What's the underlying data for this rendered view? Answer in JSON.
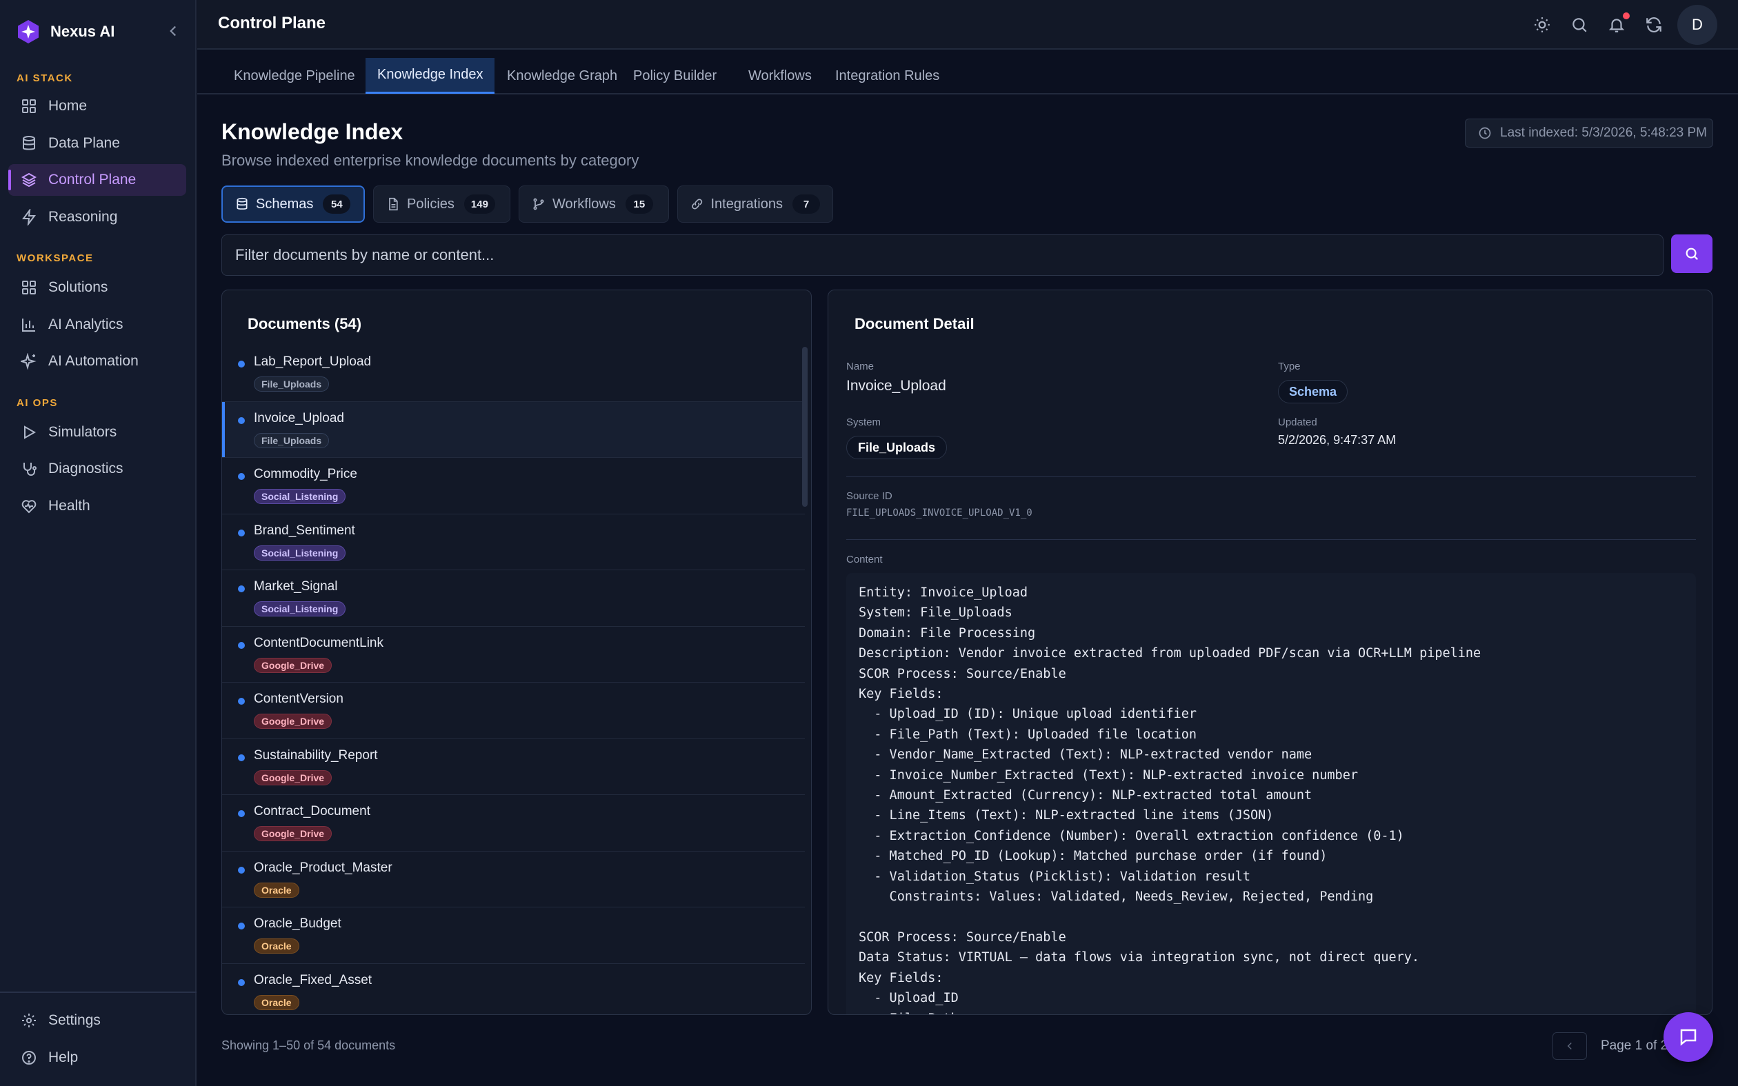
{
  "app": {
    "name": "Nexus AI",
    "brand_color": "#7c3aed",
    "accent_color": "#3b82f6"
  },
  "sidebar": {
    "sections": [
      {
        "label": "AI STACK",
        "items": [
          {
            "label": "Home",
            "icon": "grid-icon"
          },
          {
            "label": "Data Plane",
            "icon": "database-icon"
          },
          {
            "label": "Control Plane",
            "icon": "layers-icon",
            "active": true
          },
          {
            "label": "Reasoning",
            "icon": "bolt-icon"
          }
        ]
      },
      {
        "label": "WORKSPACE",
        "items": [
          {
            "label": "Solutions",
            "icon": "grid-icon"
          },
          {
            "label": "AI Analytics",
            "icon": "bar-chart-icon"
          },
          {
            "label": "AI Automation",
            "icon": "sparkle-icon"
          }
        ]
      },
      {
        "label": "AI OPS",
        "items": [
          {
            "label": "Simulators",
            "icon": "play-icon"
          },
          {
            "label": "Diagnostics",
            "icon": "stethoscope-icon"
          },
          {
            "label": "Health",
            "icon": "heart-pulse-icon"
          }
        ]
      }
    ],
    "bottom": [
      {
        "label": "Settings",
        "icon": "gear-icon"
      },
      {
        "label": "Help",
        "icon": "help-circle-icon"
      }
    ]
  },
  "header": {
    "title": "Control Plane",
    "avatar_initial": "D"
  },
  "tabs": [
    "Knowledge Pipeline",
    "Knowledge Index",
    "Knowledge Graph",
    "Policy Builder",
    "Workflows",
    "Integration Rules"
  ],
  "active_tab": "Knowledge Index",
  "page": {
    "title": "Knowledge Index",
    "subtitle": "Browse indexed enterprise knowledge documents by category",
    "last_indexed": "Last indexed: 5/3/2026, 5:48:23 PM"
  },
  "categories": [
    {
      "label": "Schemas",
      "count": "54",
      "active": true
    },
    {
      "label": "Policies",
      "count": "149"
    },
    {
      "label": "Workflows",
      "count": "15"
    },
    {
      "label": "Integrations",
      "count": "7"
    }
  ],
  "filter": {
    "placeholder": "Filter documents by name or content..."
  },
  "documents": {
    "title": "Documents (54)",
    "items": [
      {
        "name": "Lab_Report_Upload",
        "tag": "File_Uploads"
      },
      {
        "name": "Invoice_Upload",
        "tag": "File_Uploads",
        "selected": true
      },
      {
        "name": "Commodity_Price",
        "tag": "Social_Listening"
      },
      {
        "name": "Brand_Sentiment",
        "tag": "Social_Listening"
      },
      {
        "name": "Market_Signal",
        "tag": "Social_Listening"
      },
      {
        "name": "ContentDocumentLink",
        "tag": "Google_Drive"
      },
      {
        "name": "ContentVersion",
        "tag": "Google_Drive"
      },
      {
        "name": "Sustainability_Report",
        "tag": "Google_Drive"
      },
      {
        "name": "Contract_Document",
        "tag": "Google_Drive"
      },
      {
        "name": "Oracle_Product_Master",
        "tag": "Oracle"
      },
      {
        "name": "Oracle_Budget",
        "tag": "Oracle"
      },
      {
        "name": "Oracle_Fixed_Asset",
        "tag": "Oracle"
      }
    ]
  },
  "detail": {
    "title": "Document Detail",
    "name_label": "Name",
    "name": "Invoice_Upload",
    "type_label": "Type",
    "type": "Schema",
    "system_label": "System",
    "system": "File_Uploads",
    "updated_label": "Updated",
    "updated": "5/2/2026, 9:47:37 AM",
    "source_id_label": "Source ID",
    "source_id": "FILE_UPLOADS_INVOICE_UPLOAD_V1_0",
    "content_label": "Content",
    "content": "Entity: Invoice_Upload\nSystem: File_Uploads\nDomain: File Processing\nDescription: Vendor invoice extracted from uploaded PDF/scan via OCR+LLM pipeline\nSCOR Process: Source/Enable\nKey Fields:\n  - Upload_ID (ID): Unique upload identifier\n  - File_Path (Text): Uploaded file location\n  - Vendor_Name_Extracted (Text): NLP-extracted vendor name\n  - Invoice_Number_Extracted (Text): NLP-extracted invoice number\n  - Amount_Extracted (Currency): NLP-extracted total amount\n  - Line_Items (Text): NLP-extracted line items (JSON)\n  - Extraction_Confidence (Number): Overall extraction confidence (0-1)\n  - Matched_PO_ID (Lookup): Matched purchase order (if found)\n  - Validation_Status (Picklist): Validation result\n    Constraints: Values: Validated, Needs_Review, Rejected, Pending\n\nSCOR Process: Source/Enable\nData Status: VIRTUAL — data flows via integration sync, not direct query.\nKey Fields:\n  - Upload_ID\n  - File_Path"
  },
  "footer": {
    "showing": "Showing 1–50 of 54 documents",
    "page": "Page 1 of 2"
  }
}
